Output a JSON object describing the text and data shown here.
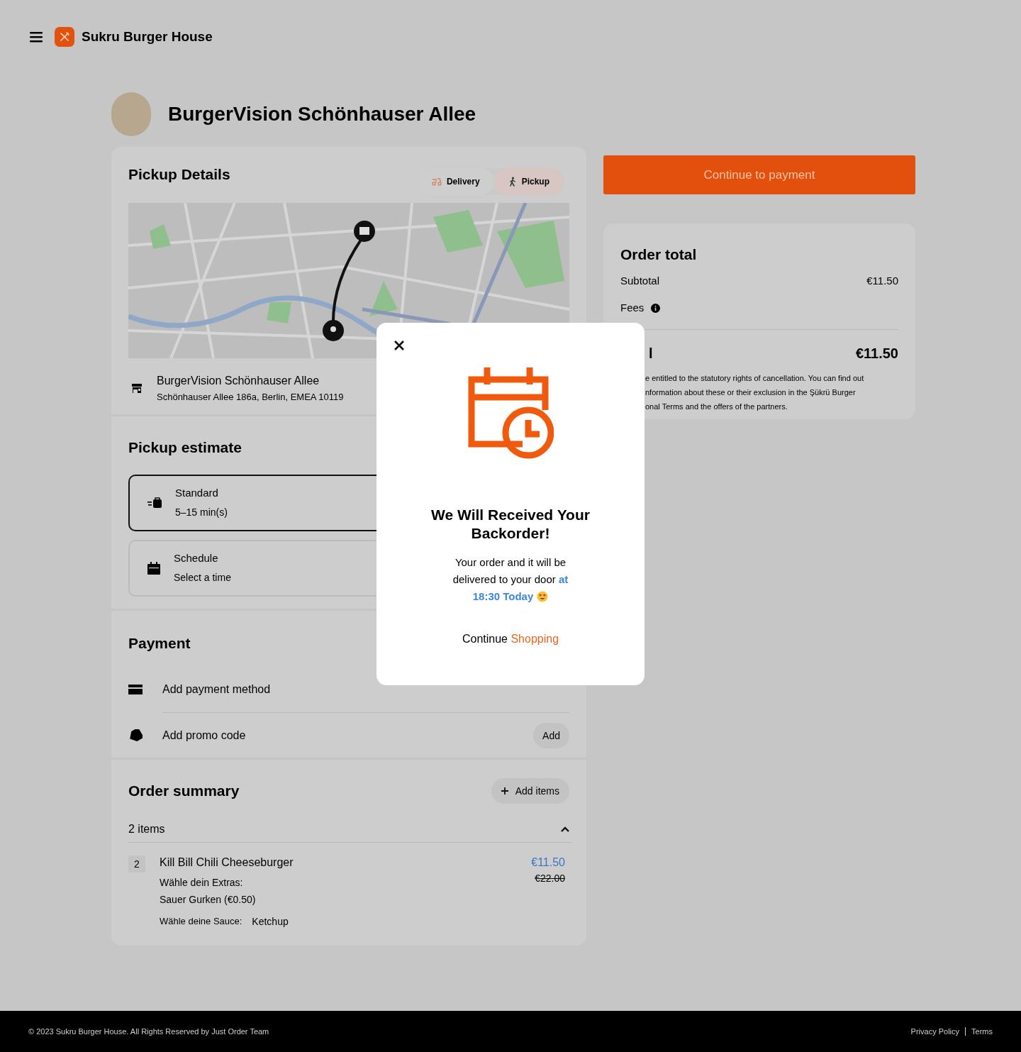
{
  "header": {
    "brand": "Sukru Burger House"
  },
  "restaurant": {
    "name": "BurgerVision Schönhauser Allee"
  },
  "pickup_details": {
    "title": "Pickup Details",
    "modes": [
      {
        "kind": "delivery",
        "label": "Delivery",
        "selected": false
      },
      {
        "kind": "pickup",
        "label": "Pickup",
        "selected": true
      }
    ],
    "store": {
      "name": "BurgerVision Schönhauser Allee",
      "address": "Schönhauser Allee 186a, Berlin, EMEA 10119"
    }
  },
  "pickup_estimate": {
    "title": "Pickup estimate",
    "options": [
      {
        "kind": "standard",
        "label": "Standard",
        "detail": "5–15 min(s)",
        "selected": true
      },
      {
        "kind": "schedule",
        "label": "Schedule",
        "detail": "Select a time",
        "selected": false
      }
    ]
  },
  "payment": {
    "title": "Payment",
    "rows": [
      {
        "kind": "card",
        "label": "Add payment method"
      },
      {
        "kind": "promo",
        "label": "Add promo code",
        "button": "Add"
      }
    ]
  },
  "order_summary": {
    "title": "Order summary",
    "add_button": "Add items",
    "count": "2 items",
    "expanded": true,
    "items": [
      {
        "quantity": "2",
        "name": "Kill Bill Chili Cheeseburger",
        "price": "€11.50",
        "original_price": "€22.00",
        "options": [
          {
            "kind": "stacked",
            "label": "Wähle dein Extras:",
            "value": "Sauer Gurken (€0.50)"
          },
          {
            "kind": "inline",
            "label": "Wähle deine Sauce:",
            "value": "Ketchup"
          }
        ]
      }
    ]
  },
  "checkout": {
    "button": "Continue to payment"
  },
  "order_total": {
    "title": "Order total",
    "subtotal_label": "Subtotal",
    "subtotal": "€11.50",
    "fees_label": "Fees",
    "total_label": "l",
    "total": "€11.50",
    "legal_lines": [
      "e entitled to the statutory rights of cancellation. You can find out",
      "nformation about these or their exclusion in the Şükrü Burger",
      "onal Terms and the offers of the partners."
    ]
  },
  "modal": {
    "title": "We Will Received Your Backorder!",
    "message": "Your order and it will be delivered to your door ",
    "highlight": "at",
    "time": "18:30 Today",
    "link_text": "Continue",
    "link_highlight": "Shopping"
  },
  "footer": {
    "copyright": "© 2023 Sukru Burger House. All Rights Reserved by Just Order Team",
    "links": [
      "Privacy Policy",
      "Terms"
    ]
  }
}
